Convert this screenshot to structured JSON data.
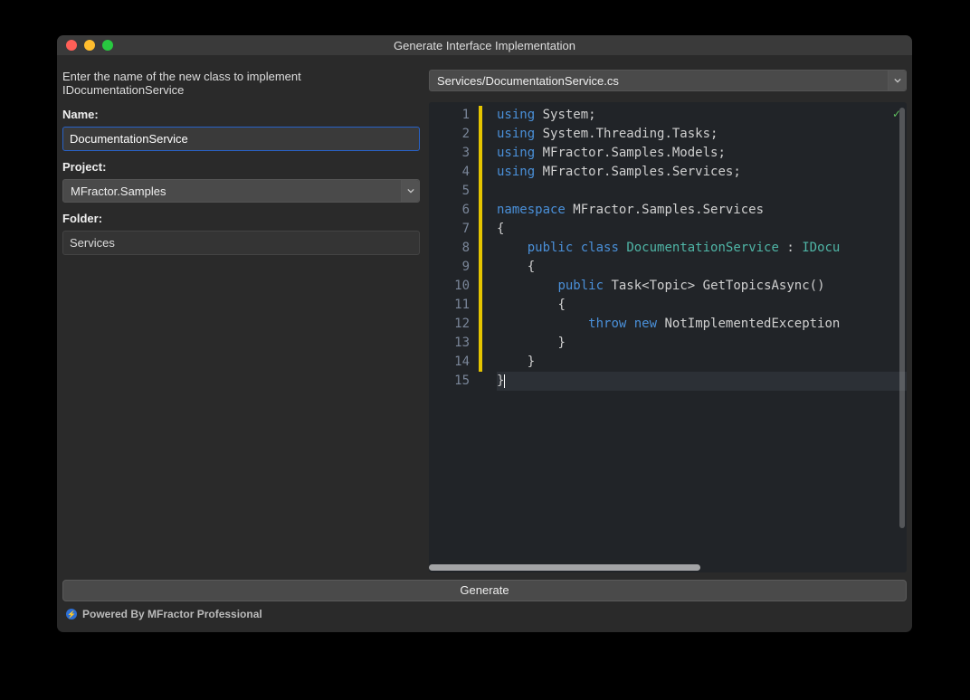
{
  "window": {
    "title": "Generate Interface Implementation"
  },
  "form": {
    "instruction": "Enter the name of the new class to implement IDocumentationService",
    "name_label": "Name:",
    "name_value": "DocumentationService",
    "project_label": "Project:",
    "project_value": "MFractor.Samples",
    "folder_label": "Folder:",
    "folder_value": "Services"
  },
  "preview": {
    "file_path": "Services/DocumentationService.cs",
    "line_count": 15,
    "code_tokens": [
      [
        [
          "kw",
          "using"
        ],
        [
          "sp",
          " "
        ],
        [
          "id",
          "System"
        ],
        [
          "p",
          ";"
        ]
      ],
      [
        [
          "kw",
          "using"
        ],
        [
          "sp",
          " "
        ],
        [
          "id",
          "System.Threading.Tasks"
        ],
        [
          "p",
          ";"
        ]
      ],
      [
        [
          "kw",
          "using"
        ],
        [
          "sp",
          " "
        ],
        [
          "id",
          "MFractor.Samples.Models"
        ],
        [
          "p",
          ";"
        ]
      ],
      [
        [
          "kw",
          "using"
        ],
        [
          "sp",
          " "
        ],
        [
          "id",
          "MFractor.Samples.Services"
        ],
        [
          "p",
          ";"
        ]
      ],
      [],
      [
        [
          "kw",
          "namespace"
        ],
        [
          "sp",
          " "
        ],
        [
          "id",
          "MFractor.Samples.Services"
        ]
      ],
      [
        [
          "p",
          "{"
        ]
      ],
      [
        [
          "sp",
          "    "
        ],
        [
          "kw",
          "public"
        ],
        [
          "sp",
          " "
        ],
        [
          "kw",
          "class"
        ],
        [
          "sp",
          " "
        ],
        [
          "type",
          "DocumentationService"
        ],
        [
          "sp",
          " "
        ],
        [
          "p",
          ":"
        ],
        [
          "sp",
          " "
        ],
        [
          "type",
          "IDocu"
        ]
      ],
      [
        [
          "sp",
          "    "
        ],
        [
          "p",
          "{"
        ]
      ],
      [
        [
          "sp",
          "        "
        ],
        [
          "kw",
          "public"
        ],
        [
          "sp",
          " "
        ],
        [
          "id",
          "Task"
        ],
        [
          "p",
          "<"
        ],
        [
          "id",
          "Topic"
        ],
        [
          "p",
          ">"
        ],
        [
          "sp",
          " "
        ],
        [
          "id",
          "GetTopicsAsync"
        ],
        [
          "p",
          "()"
        ]
      ],
      [
        [
          "sp",
          "        "
        ],
        [
          "p",
          "{"
        ]
      ],
      [
        [
          "sp",
          "            "
        ],
        [
          "kw",
          "throw"
        ],
        [
          "sp",
          " "
        ],
        [
          "kw",
          "new"
        ],
        [
          "sp",
          " "
        ],
        [
          "id",
          "NotImplementedException"
        ]
      ],
      [
        [
          "sp",
          "        "
        ],
        [
          "p",
          "}"
        ]
      ],
      [
        [
          "sp",
          "    "
        ],
        [
          "p",
          "}"
        ]
      ],
      [
        [
          "p",
          "}"
        ]
      ]
    ],
    "current_line_index": 14
  },
  "buttons": {
    "generate": "Generate"
  },
  "footer": {
    "text": "Powered By MFractor Professional"
  }
}
